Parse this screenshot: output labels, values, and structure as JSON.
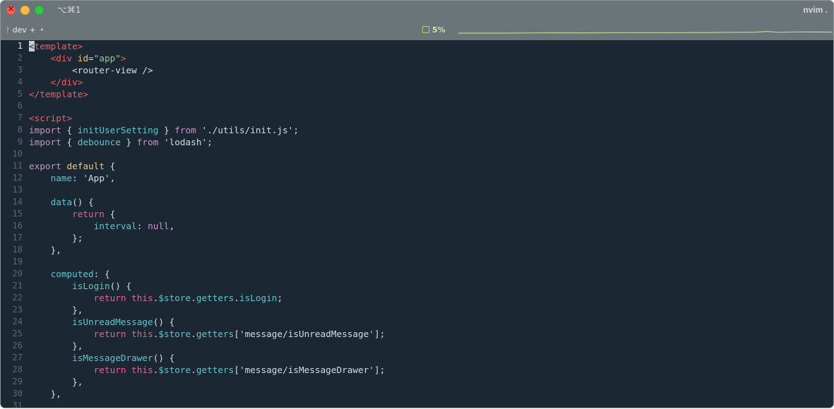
{
  "window": {
    "tab_shortcut": "⌥⌘1",
    "app_title": "nvim ."
  },
  "status": {
    "branch_glyph": "ᚹ",
    "branch": "dev",
    "branch_suffix": "+",
    "dirty_marker": "•",
    "cpu": "5%"
  },
  "editor": {
    "current_line": 1,
    "lines": [
      {
        "n": "1",
        "tokens": [
          {
            "t": "<",
            "c": "cursor"
          },
          {
            "t": "template",
            "c": "c-red"
          },
          {
            "t": ">",
            "c": "c-red"
          }
        ]
      },
      {
        "n": "2",
        "tokens": [
          {
            "t": "    "
          },
          {
            "t": "<div",
            "c": "c-red"
          },
          {
            "t": " "
          },
          {
            "t": "id",
            "c": "c-yellow"
          },
          {
            "t": "=",
            "c": "c-white"
          },
          {
            "t": "\"app\"",
            "c": "c-green"
          },
          {
            "t": ">",
            "c": "c-red"
          }
        ]
      },
      {
        "n": "3",
        "tokens": [
          {
            "t": "        "
          },
          {
            "t": "<router-view />",
            "c": "c-white"
          }
        ]
      },
      {
        "n": "4",
        "tokens": [
          {
            "t": "    "
          },
          {
            "t": "</div>",
            "c": "c-red"
          }
        ]
      },
      {
        "n": "5",
        "tokens": [
          {
            "t": "</template>",
            "c": "c-red"
          }
        ]
      },
      {
        "n": "6",
        "tokens": []
      },
      {
        "n": "7",
        "tokens": [
          {
            "t": "<script>",
            "c": "c-red"
          }
        ]
      },
      {
        "n": "8",
        "tokens": [
          {
            "t": "import",
            "c": "c-purple"
          },
          {
            "t": " { ",
            "c": "c-white"
          },
          {
            "t": "initUserSetting",
            "c": "c-cyan"
          },
          {
            "t": " } ",
            "c": "c-white"
          },
          {
            "t": "from",
            "c": "c-purple"
          },
          {
            "t": " "
          },
          {
            "t": "'./utils/init.js'",
            "c": "c-white"
          },
          {
            "t": ";",
            "c": "c-white"
          }
        ]
      },
      {
        "n": "9",
        "tokens": [
          {
            "t": "import",
            "c": "c-purple"
          },
          {
            "t": " { ",
            "c": "c-white"
          },
          {
            "t": "debounce",
            "c": "c-cyan"
          },
          {
            "t": " } ",
            "c": "c-white"
          },
          {
            "t": "from",
            "c": "c-purple"
          },
          {
            "t": " "
          },
          {
            "t": "'lodash'",
            "c": "c-white"
          },
          {
            "t": ";",
            "c": "c-white"
          }
        ]
      },
      {
        "n": "10",
        "tokens": []
      },
      {
        "n": "11",
        "tokens": [
          {
            "t": "export",
            "c": "c-purple"
          },
          {
            "t": " "
          },
          {
            "t": "default",
            "c": "c-yellow"
          },
          {
            "t": " {",
            "c": "c-white"
          }
        ]
      },
      {
        "n": "12",
        "tokens": [
          {
            "t": "    "
          },
          {
            "t": "name",
            "c": "c-cyan"
          },
          {
            "t": ": ",
            "c": "c-white"
          },
          {
            "t": "'App'",
            "c": "c-white"
          },
          {
            "t": ",",
            "c": "c-white"
          }
        ]
      },
      {
        "n": "13",
        "tokens": []
      },
      {
        "n": "14",
        "tokens": [
          {
            "t": "    "
          },
          {
            "t": "data",
            "c": "c-cyan"
          },
          {
            "t": "() {",
            "c": "c-white"
          }
        ]
      },
      {
        "n": "15",
        "tokens": [
          {
            "t": "        "
          },
          {
            "t": "return",
            "c": "c-pink"
          },
          {
            "t": " {",
            "c": "c-white"
          }
        ]
      },
      {
        "n": "16",
        "tokens": [
          {
            "t": "            "
          },
          {
            "t": "interval",
            "c": "c-cyan"
          },
          {
            "t": ": ",
            "c": "c-white"
          },
          {
            "t": "null",
            "c": "c-purple"
          },
          {
            "t": ",",
            "c": "c-white"
          }
        ]
      },
      {
        "n": "17",
        "tokens": [
          {
            "t": "        "
          },
          {
            "t": "};",
            "c": "c-white"
          }
        ]
      },
      {
        "n": "18",
        "tokens": [
          {
            "t": "    "
          },
          {
            "t": "},",
            "c": "c-white"
          }
        ]
      },
      {
        "n": "19",
        "tokens": []
      },
      {
        "n": "20",
        "tokens": [
          {
            "t": "    "
          },
          {
            "t": "computed",
            "c": "c-cyan"
          },
          {
            "t": ": {",
            "c": "c-white"
          }
        ]
      },
      {
        "n": "21",
        "tokens": [
          {
            "t": "        "
          },
          {
            "t": "isLogin",
            "c": "c-cyan"
          },
          {
            "t": "() {",
            "c": "c-white"
          }
        ]
      },
      {
        "n": "22",
        "tokens": [
          {
            "t": "            "
          },
          {
            "t": "return",
            "c": "c-pink"
          },
          {
            "t": " "
          },
          {
            "t": "this",
            "c": "c-pink"
          },
          {
            "t": ".",
            "c": "c-white"
          },
          {
            "t": "$store",
            "c": "c-cyan"
          },
          {
            "t": ".",
            "c": "c-white"
          },
          {
            "t": "getters",
            "c": "c-cyan"
          },
          {
            "t": ".",
            "c": "c-white"
          },
          {
            "t": "isLogin",
            "c": "c-cyan"
          },
          {
            "t": ";",
            "c": "c-white"
          }
        ]
      },
      {
        "n": "23",
        "tokens": [
          {
            "t": "        "
          },
          {
            "t": "},",
            "c": "c-white"
          }
        ]
      },
      {
        "n": "24",
        "tokens": [
          {
            "t": "        "
          },
          {
            "t": "isUnreadMessage",
            "c": "c-cyan"
          },
          {
            "t": "() {",
            "c": "c-white"
          }
        ]
      },
      {
        "n": "25",
        "tokens": [
          {
            "t": "            "
          },
          {
            "t": "return",
            "c": "c-pink"
          },
          {
            "t": " "
          },
          {
            "t": "this",
            "c": "c-pink"
          },
          {
            "t": ".",
            "c": "c-white"
          },
          {
            "t": "$store",
            "c": "c-cyan"
          },
          {
            "t": ".",
            "c": "c-white"
          },
          {
            "t": "getters",
            "c": "c-cyan"
          },
          {
            "t": "[",
            "c": "c-white"
          },
          {
            "t": "'message/isUnreadMessage'",
            "c": "c-white"
          },
          {
            "t": "];",
            "c": "c-white"
          }
        ]
      },
      {
        "n": "26",
        "tokens": [
          {
            "t": "        "
          },
          {
            "t": "},",
            "c": "c-white"
          }
        ]
      },
      {
        "n": "27",
        "tokens": [
          {
            "t": "        "
          },
          {
            "t": "isMessageDrawer",
            "c": "c-cyan"
          },
          {
            "t": "() {",
            "c": "c-white"
          }
        ]
      },
      {
        "n": "28",
        "tokens": [
          {
            "t": "            "
          },
          {
            "t": "return",
            "c": "c-pink"
          },
          {
            "t": " "
          },
          {
            "t": "this",
            "c": "c-pink"
          },
          {
            "t": ".",
            "c": "c-white"
          },
          {
            "t": "$store",
            "c": "c-cyan"
          },
          {
            "t": ".",
            "c": "c-white"
          },
          {
            "t": "getters",
            "c": "c-cyan"
          },
          {
            "t": "[",
            "c": "c-white"
          },
          {
            "t": "'message/isMessageDrawer'",
            "c": "c-white"
          },
          {
            "t": "];",
            "c": "c-white"
          }
        ]
      },
      {
        "n": "29",
        "tokens": [
          {
            "t": "        "
          },
          {
            "t": "},",
            "c": "c-white"
          }
        ]
      },
      {
        "n": "30",
        "tokens": [
          {
            "t": "    "
          },
          {
            "t": "},",
            "c": "c-white"
          }
        ]
      },
      {
        "n": "31",
        "tokens": []
      }
    ]
  },
  "colors": {
    "background": "#1b2733",
    "titlebar": "#6b7479",
    "tag": "#ec5f67",
    "keyword": "#c594c5",
    "identifier": "#62c4cd",
    "attribute": "#f5c56b",
    "string": "#99c794"
  }
}
